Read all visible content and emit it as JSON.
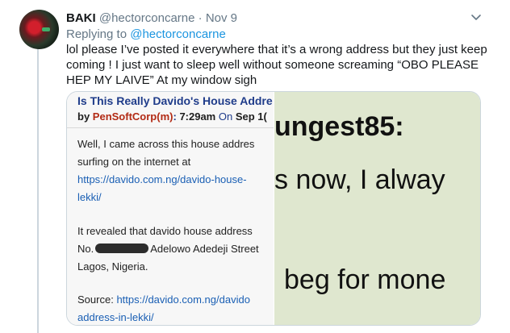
{
  "tweet": {
    "name": "BAKI",
    "handle": "@hectorconcarne",
    "dot": "·",
    "date": "Nov 9",
    "reply_prefix": "Replying to",
    "reply_handle": "@hectorconcarne",
    "text": "lol please I’ve posted it everywhere that it’s a wrong address but they just keep coming ! I just want to sleep well without someone screaming “OBO PLEASE HEP MY LAIVE” At my window sigh"
  },
  "media": {
    "left": {
      "title": "Is This Really Davido's House Addre",
      "by": "by",
      "author": "PenSoftCorp",
      "author_suffix": "(m)",
      "colon": ":",
      "time": "7:29am",
      "on": "On",
      "date": "Sep 1(",
      "line1": "Well, I came across this house addres",
      "line2": "surfing on the internet at",
      "link1a": "https://davido.com.ng/davido-house-",
      "link1b": "lekki/",
      "line3": "It revealed that davido house address",
      "line4_prefix": "No.",
      "line4_suffix": "Adelowo Adedeji Street",
      "line5": "Lagos, Nigeria.",
      "source_label": "Source:",
      "link2a": "https://davido.com.ng/davido",
      "link2b": "address-in-lekki/"
    },
    "right": {
      "line1": "ungest85:",
      "line2": "s now, I alway",
      "line3": "beg for mone"
    }
  },
  "colors": {
    "link": "#1b95e0",
    "secondary_text": "#657786",
    "border": "#ccd6dd"
  },
  "icons": {
    "caret": "chevron-down-icon",
    "avatar": "avatar"
  }
}
